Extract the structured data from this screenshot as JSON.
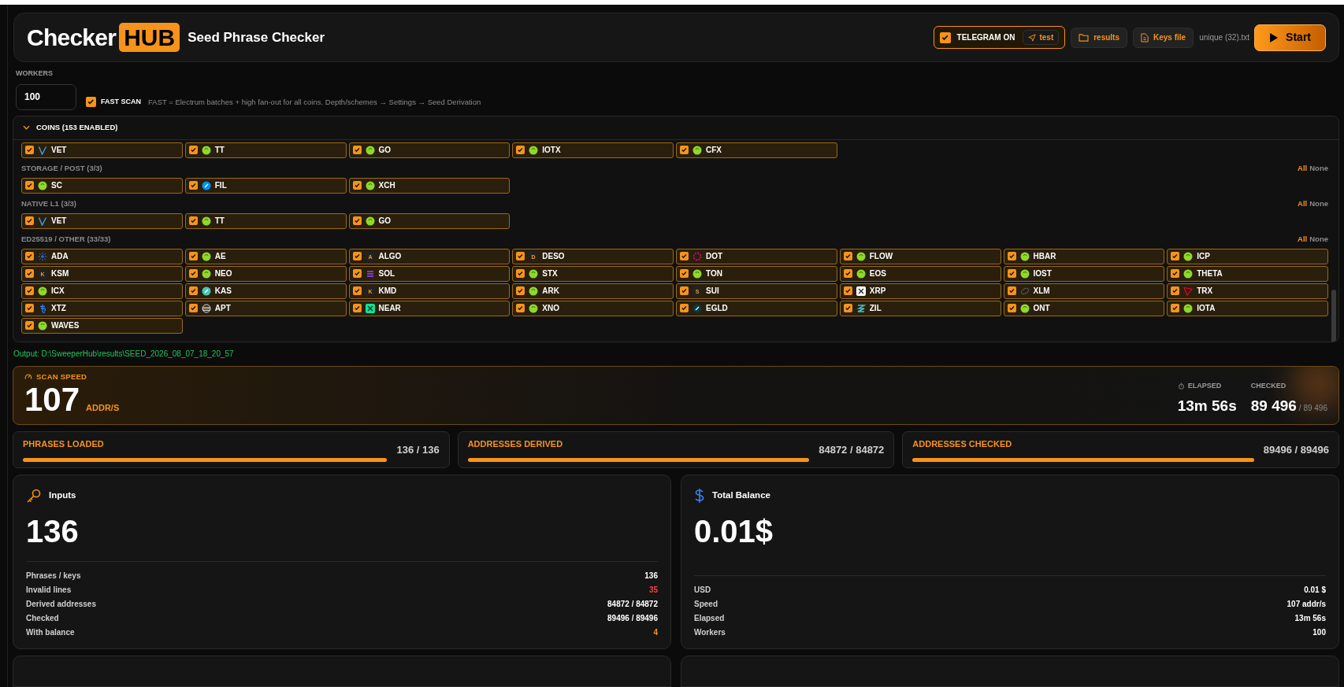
{
  "header": {
    "logo_left": "Checker",
    "logo_right": "HUB",
    "title": "Seed Phrase Checker",
    "telegram": {
      "label": "TELEGRAM ON",
      "checked": true,
      "test_label": "test"
    },
    "results_button": "results",
    "keys_button": "Keys file",
    "file_name": "unique (32).txt",
    "start_button": "Start"
  },
  "workers": {
    "label": "WORKERS",
    "value": "100"
  },
  "fast_scan": {
    "label": "FAST SCAN",
    "checked": true,
    "hint": "FAST = Electrum batches + high fan-out for all coins. Depth/schemes → Settings → Seed Derivation"
  },
  "coins": {
    "title": "COINS (153 ENABLED)",
    "expanded": true,
    "sections": [
      {
        "coins": [
          {
            "name": "VET",
            "checked": true,
            "kind": "v",
            "color": "#3b9ae1"
          },
          {
            "name": "TT",
            "checked": true,
            "kind": "blob"
          },
          {
            "name": "GO",
            "checked": true,
            "kind": "blob"
          },
          {
            "name": "IOTX",
            "checked": true,
            "kind": "blob"
          },
          {
            "name": "CFX",
            "checked": true,
            "kind": "blob"
          }
        ]
      },
      {
        "label": "STORAGE / POST (3/3)",
        "all": "All",
        "none": "None",
        "coins": [
          {
            "name": "SC",
            "checked": true,
            "kind": "blob"
          },
          {
            "name": "FIL",
            "checked": true,
            "kind": "dot",
            "color": "#0090ff"
          },
          {
            "name": "XCH",
            "checked": true,
            "kind": "blob"
          }
        ]
      },
      {
        "label": "NATIVE L1 (3/3)",
        "all": "All",
        "none": "None",
        "coins": [
          {
            "name": "VET",
            "checked": true,
            "kind": "v",
            "color": "#3b9ae1"
          },
          {
            "name": "TT",
            "checked": true,
            "kind": "blob"
          },
          {
            "name": "GO",
            "checked": true,
            "kind": "blob"
          }
        ]
      },
      {
        "label": "ED25519 / OTHER (33/33)",
        "all": "All",
        "none": "None",
        "coins": [
          {
            "name": "ADA",
            "checked": true,
            "kind": "burst"
          },
          {
            "name": "AE",
            "checked": true,
            "kind": "blob"
          },
          {
            "name": "ALGO",
            "checked": true,
            "kind": "glyph",
            "glyph": "A"
          },
          {
            "name": "DESO",
            "checked": true,
            "kind": "glyph",
            "glyph": "D"
          },
          {
            "name": "DOT",
            "checked": true,
            "kind": "ring"
          },
          {
            "name": "FLOW",
            "checked": true,
            "kind": "blob"
          },
          {
            "name": "HBAR",
            "checked": true,
            "kind": "blob"
          },
          {
            "name": "ICP",
            "checked": true,
            "kind": "blob"
          },
          {
            "name": "KSM",
            "checked": true,
            "kind": "glyph",
            "glyph": "K"
          },
          {
            "name": "NEO",
            "checked": true,
            "kind": "blob"
          },
          {
            "name": "SOL",
            "checked": true,
            "kind": "stripes"
          },
          {
            "name": "STX",
            "checked": true,
            "kind": "blob"
          },
          {
            "name": "TON",
            "checked": true,
            "kind": "blob"
          },
          {
            "name": "EOS",
            "checked": true,
            "kind": "blob"
          },
          {
            "name": "IOST",
            "checked": true,
            "kind": "blob"
          },
          {
            "name": "THETA",
            "checked": true,
            "kind": "blob"
          },
          {
            "name": "ICX",
            "checked": true,
            "kind": "blob"
          },
          {
            "name": "KAS",
            "checked": true,
            "kind": "dot",
            "color": "#49c5b6"
          },
          {
            "name": "KMD",
            "checked": true,
            "kind": "glyph",
            "glyph": "K"
          },
          {
            "name": "ARK",
            "checked": true,
            "kind": "blob"
          },
          {
            "name": "SUI",
            "checked": true,
            "kind": "glyph",
            "glyph": "S"
          },
          {
            "name": "XRP",
            "checked": true,
            "kind": "square",
            "color": "#ffffff"
          },
          {
            "name": "XLM",
            "checked": true,
            "kind": "swirl",
            "color": "#555555"
          },
          {
            "name": "TRX",
            "checked": true,
            "kind": "triangle"
          },
          {
            "name": "XTZ",
            "checked": true,
            "kind": "tez"
          },
          {
            "name": "APT",
            "checked": true,
            "kind": "lines",
            "color": "#dddddd"
          },
          {
            "name": "NEAR",
            "checked": true,
            "kind": "square",
            "color": "#00ec97"
          },
          {
            "name": "XNO",
            "checked": true,
            "kind": "blob"
          },
          {
            "name": "EGLD",
            "checked": true,
            "kind": "dot",
            "color": "#0a3b3b"
          },
          {
            "name": "ZIL",
            "checked": true,
            "kind": "zil"
          },
          {
            "name": "ONT",
            "checked": true,
            "kind": "blob"
          },
          {
            "name": "IOTA",
            "checked": true,
            "kind": "blob"
          },
          {
            "name": "WAVES",
            "checked": true,
            "kind": "blob"
          }
        ]
      }
    ]
  },
  "output": "Output: D:\\SweeperHub\\results\\SEED_2026_08_07_18_20_57",
  "speed": {
    "label": "SCAN SPEED",
    "value": "107",
    "unit": "ADDR/S",
    "elapsed_label": "ELAPSED",
    "elapsed": "13m 56s",
    "checked_label": "CHECKED",
    "checked": "89 496",
    "checked_total": "/ 89 496"
  },
  "progress": [
    {
      "label": "PHRASES LOADED",
      "reading": "136 / 136",
      "level": 1
    },
    {
      "label": "ADDRESSES DERIVED",
      "reading": "84872 / 84872",
      "level": 1
    },
    {
      "label": "ADDRESSES CHECKED",
      "reading": "89496 / 89496",
      "level": 1
    }
  ],
  "panels": [
    {
      "kind": "key",
      "title": "Inputs",
      "value": "136",
      "rows": [
        {
          "label": "Phrases / keys",
          "value": "136",
          "color": "#ffffff"
        },
        {
          "label": "Invalid lines",
          "value": "35",
          "color": "#ef4444"
        },
        {
          "label": "Derived addresses",
          "value": "84872 / 84872",
          "color": "#ffffff"
        },
        {
          "label": "Checked",
          "value": "89496 / 89496",
          "color": "#ffffff"
        },
        {
          "label": "With balance",
          "value": "4",
          "color": "#f7931a"
        }
      ]
    },
    {
      "kind": "dollar",
      "title": "Total Balance",
      "value": "0.01$",
      "rows": [
        {
          "label": "USD",
          "value": "0.01 $",
          "color": "#ffffff"
        },
        {
          "label": "Speed",
          "value": "107 addr/s",
          "color": "#ffffff"
        },
        {
          "label": "Elapsed",
          "value": "13m 56s",
          "color": "#ffffff"
        },
        {
          "label": "Workers",
          "value": "100",
          "color": "#ffffff"
        }
      ]
    }
  ]
}
